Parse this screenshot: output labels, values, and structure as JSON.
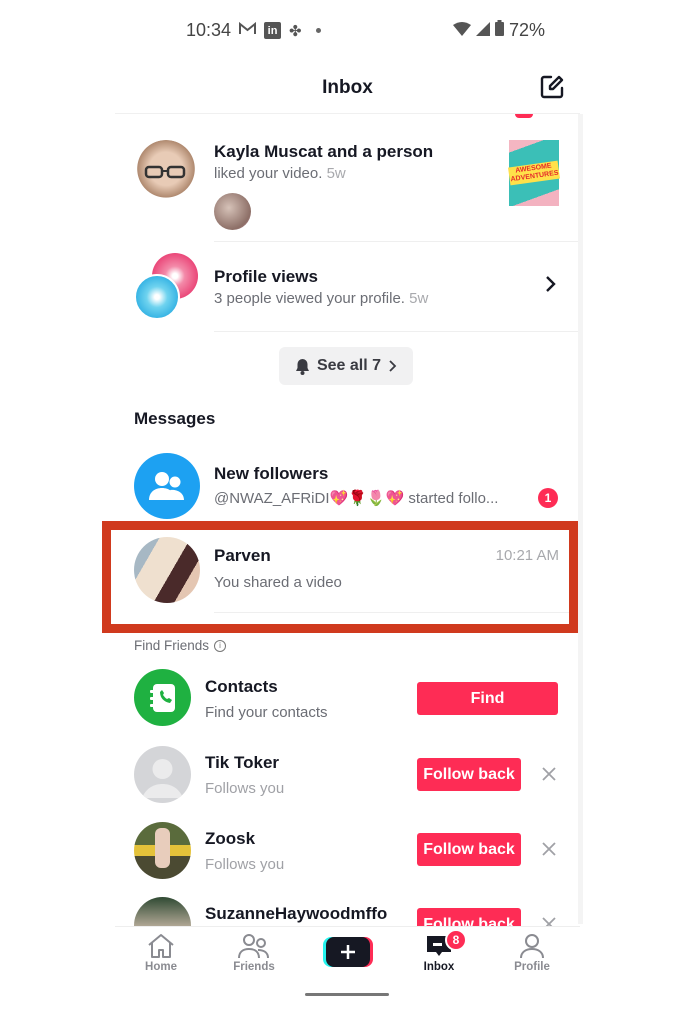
{
  "status_bar": {
    "time": "10:34",
    "notification_icons": [
      "gmail-icon",
      "linkedin-icon",
      "pinwheel-icon",
      "dot-icon"
    ],
    "battery": "72%"
  },
  "header": {
    "title": "Inbox",
    "compose_icon": "compose-icon"
  },
  "activity": {
    "items": [
      {
        "title": "Kayla Muscat and a person",
        "subtitle": "liked your video.",
        "age": "5w",
        "thumbnail_text": "AWESOME ADVENTURES"
      },
      {
        "title": "Profile views",
        "subtitle": "3 people viewed your profile.",
        "age": "5w"
      }
    ],
    "see_all_label": "See all 7"
  },
  "messages": {
    "section_label": "Messages",
    "items": [
      {
        "title": "New followers",
        "subtitle": "@NWAZ_AFRiDI💖🌹🌷💖 started follo...",
        "badge": "1"
      },
      {
        "title": "Parven",
        "subtitle": "You shared a video",
        "time": "10:21 AM"
      }
    ]
  },
  "find_friends": {
    "section_label": "Find Friends",
    "contacts": {
      "title": "Contacts",
      "subtitle": "Find your contacts",
      "button": "Find"
    },
    "suggestions": [
      {
        "name": "Tik Toker",
        "subtitle": "Follows you",
        "button": "Follow back"
      },
      {
        "name": "Zoosk",
        "subtitle": "Follows you",
        "button": "Follow back"
      },
      {
        "name": "SuzanneHaywoodmffo",
        "subtitle": "",
        "button": "Follow back"
      }
    ]
  },
  "bottom_nav": {
    "items": [
      {
        "label": "Home"
      },
      {
        "label": "Friends"
      },
      {
        "label": ""
      },
      {
        "label": "Inbox",
        "badge": "8",
        "active": true
      },
      {
        "label": "Profile"
      }
    ]
  },
  "colors": {
    "accent": "#fe2c55",
    "highlight": "#d03a1e",
    "followers_blue": "#1da1f2",
    "contacts_green": "#1fb141"
  }
}
